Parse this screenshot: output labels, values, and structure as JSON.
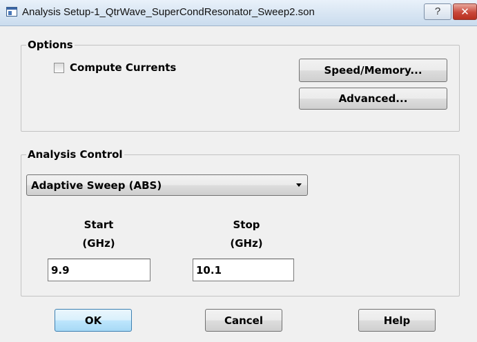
{
  "window": {
    "title": "Analysis Setup-1_QtrWave_SuperCondResonator_Sweep2.son",
    "help_glyph": "?",
    "close_glyph": "✕"
  },
  "options": {
    "group_label": "Options",
    "compute_currents_label": "Compute Currents",
    "compute_currents_checked": false,
    "speed_memory_label": "Speed/Memory...",
    "advanced_label": "Advanced..."
  },
  "analysis_control": {
    "group_label": "Analysis Control",
    "sweep_type": "Adaptive Sweep (ABS)",
    "start_label_line1": "Start",
    "start_label_line2": "(GHz)",
    "start_value": "9.9",
    "stop_label_line1": "Stop",
    "stop_label_line2": "(GHz)",
    "stop_value": "10.1"
  },
  "footer": {
    "ok_label": "OK",
    "cancel_label": "Cancel",
    "help_label": "Help"
  },
  "colors": {
    "window_bg": "#f0f0f0",
    "title_bar": "#dce8f4",
    "close_button": "#c9483a",
    "default_button": "#bee6fd"
  }
}
